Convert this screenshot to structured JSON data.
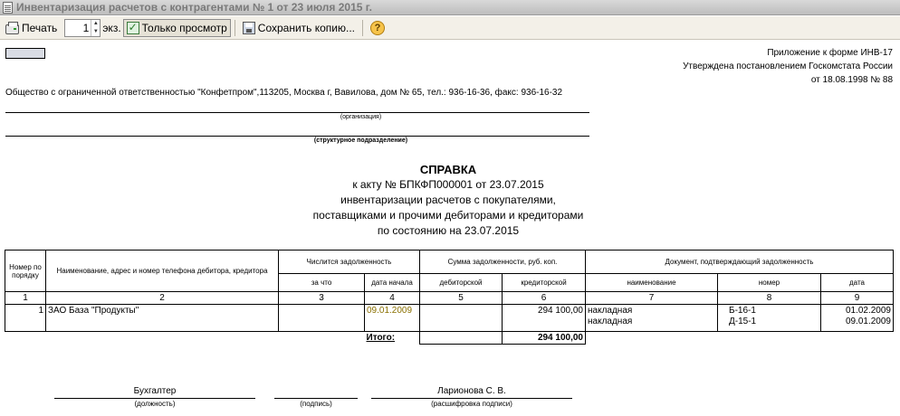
{
  "window": {
    "title": "Инвентаризация расчетов с контрагентами № 1 от 23 июля 2015 г."
  },
  "toolbar": {
    "print_label": "Печать",
    "copies_value": "1",
    "copies_unit": "экз.",
    "view_only_label": "Только просмотр",
    "save_copy_label": "Сохранить копию...",
    "help_symbol": "?"
  },
  "document": {
    "appendix": [
      "Приложение к форме ИНВ-17",
      "Утверждена постановлением Госкомстата России",
      "от 18.08.1998 № 88"
    ],
    "organization_text": "Общество с ограниченной ответственностью \"Конфетпром\",113205, Москва г, Вавилова, дом № 65, тел.: 936-16-36, факс: 936-16-32",
    "organization_caption": "(организация)",
    "department_caption": "(структурное подразделение)",
    "heading": {
      "title": "СПРАВКА",
      "line1": "к акту № БПКФП000001 от 23.07.2015",
      "line2": "инвентаризации расчетов с покупателями,",
      "line3": "поставщиками и прочими дебиторами и кредиторами",
      "line4": "по состоянию на 23.07.2015"
    },
    "table": {
      "headers": {
        "row_num": "Номер по порядку",
        "name": "Наименование, адрес и номер телефона дебитора, кредитора",
        "debt_group": "Числится задолженность",
        "sum_group": "Сумма задолженности, руб. коп.",
        "doc_group": "Документ, подтверждающий задолженность",
        "for_what": "за что",
        "start_date": "дата начала",
        "debit": "дебиторской",
        "credit": "кредиторской",
        "doc_name": "наименование",
        "doc_number": "номер",
        "doc_date": "дата"
      },
      "column_numbers": [
        "1",
        "2",
        "3",
        "4",
        "5",
        "6",
        "7",
        "8",
        "9"
      ],
      "rows": [
        {
          "n": "1",
          "name": "ЗАО База \"Продукты\"",
          "for_what": "",
          "start_date": "09.01.2009",
          "debit": "",
          "credit": "294 100,00",
          "docs": [
            {
              "name": "накладная",
              "number": "Б-16-1",
              "date": "01.02.2009"
            },
            {
              "name": "накладная",
              "number": "Д-15-1",
              "date": "09.01.2009"
            }
          ]
        }
      ],
      "total_label": "Итого:",
      "total_debit": "",
      "total_credit": "294 100,00"
    },
    "signature": {
      "position_value": "Бухгалтер",
      "position_caption": "(должность)",
      "sign_caption": "(подпись)",
      "name_value": "Ларионова С. В.",
      "name_caption": "(расшифровка подписи)"
    }
  }
}
